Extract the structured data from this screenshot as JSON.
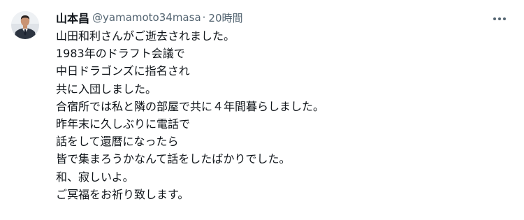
{
  "tweet": {
    "author_name": "山本昌",
    "author_handle": "@yamamoto34masa",
    "separator": "·",
    "timestamp": "20時間",
    "more_icon": "more-horizontal-icon",
    "lines": [
      "山田和利さんがご逝去されました。",
      "1983年のドラフト会議で",
      "中日ドラゴンズに指名され",
      "共に入団しました。",
      "合宿所では私と隣の部屋で共に４年間暮らしました。",
      "昨年末に久しぶりに電話で",
      "話をして還暦になったら",
      "皆で集まろうかなんて話をしたばかりでした。",
      "和、寂しいよ。",
      "ご冥福をお祈り致します。"
    ]
  },
  "colors": {
    "text_primary": "#0f1419",
    "text_secondary": "#536471",
    "background": "#ffffff"
  }
}
